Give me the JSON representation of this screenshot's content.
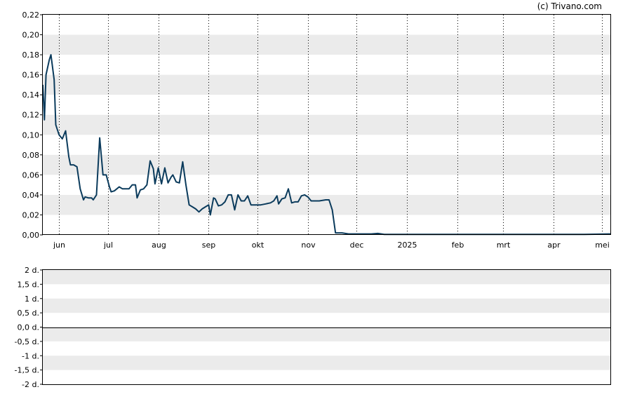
{
  "copyright": "(c) Trivano.com",
  "chart_data": [
    {
      "type": "line",
      "y_ticks": [
        "0,00",
        "0,02",
        "0,04",
        "0,06",
        "0,08",
        "0,10",
        "0,12",
        "0,14",
        "0,16",
        "0,18",
        "0,20",
        "0,22"
      ],
      "ylim": [
        0,
        0.22
      ],
      "grid": "alternating horizontal bands, dotted vertical month lines",
      "x_ticks": [
        {
          "label": "jun",
          "date": "2024-06-01"
        },
        {
          "label": "jul",
          "date": "2024-07-01"
        },
        {
          "label": "aug",
          "date": "2024-08-01"
        },
        {
          "label": "sep",
          "date": "2024-09-01"
        },
        {
          "label": "okt",
          "date": "2024-10-01"
        },
        {
          "label": "nov",
          "date": "2024-11-01"
        },
        {
          "label": "dec",
          "date": "2024-12-01"
        },
        {
          "label": "2025",
          "date": "2025-01-01"
        },
        {
          "label": "feb",
          "date": "2025-02-01"
        },
        {
          "label": "mrt",
          "date": "2025-03-01"
        },
        {
          "label": "apr",
          "date": "2025-04-01"
        },
        {
          "label": "mei",
          "date": "2025-05-01"
        }
      ],
      "xlim": [
        "2024-05-22",
        "2025-05-06"
      ],
      "line_color": "#0b3b5c",
      "series": [
        {
          "points": [
            [
              "2024-05-22",
              0.15
            ],
            [
              "2024-05-23",
              0.115
            ],
            [
              "2024-05-24",
              0.16
            ],
            [
              "2024-05-26",
              0.175
            ],
            [
              "2024-05-27",
              0.18
            ],
            [
              "2024-05-29",
              0.155
            ],
            [
              "2024-05-30",
              0.11
            ],
            [
              "2024-06-01",
              0.1
            ],
            [
              "2024-06-03",
              0.096
            ],
            [
              "2024-06-05",
              0.104
            ],
            [
              "2024-06-07",
              0.078
            ],
            [
              "2024-06-08",
              0.07
            ],
            [
              "2024-06-10",
              0.07
            ],
            [
              "2024-06-12",
              0.068
            ],
            [
              "2024-06-14",
              0.046
            ],
            [
              "2024-06-16",
              0.035
            ],
            [
              "2024-06-17",
              0.038
            ],
            [
              "2024-06-19",
              0.037
            ],
            [
              "2024-06-21",
              0.037
            ],
            [
              "2024-06-22",
              0.035
            ],
            [
              "2024-06-24",
              0.04
            ],
            [
              "2024-06-26",
              0.097
            ],
            [
              "2024-06-28",
              0.06
            ],
            [
              "2024-06-30",
              0.06
            ],
            [
              "2024-07-02",
              0.048
            ],
            [
              "2024-07-03",
              0.043
            ],
            [
              "2024-07-05",
              0.044
            ],
            [
              "2024-07-08",
              0.048
            ],
            [
              "2024-07-10",
              0.046
            ],
            [
              "2024-07-12",
              0.046
            ],
            [
              "2024-07-14",
              0.046
            ],
            [
              "2024-07-16",
              0.05
            ],
            [
              "2024-07-18",
              0.05
            ],
            [
              "2024-07-19",
              0.037
            ],
            [
              "2024-07-21",
              0.045
            ],
            [
              "2024-07-23",
              0.046
            ],
            [
              "2024-07-25",
              0.05
            ],
            [
              "2024-07-27",
              0.074
            ],
            [
              "2024-07-29",
              0.066
            ],
            [
              "2024-07-30",
              0.051
            ],
            [
              "2024-08-01",
              0.067
            ],
            [
              "2024-08-03",
              0.051
            ],
            [
              "2024-08-05",
              0.067
            ],
            [
              "2024-08-07",
              0.052
            ],
            [
              "2024-08-09",
              0.058
            ],
            [
              "2024-08-10",
              0.06
            ],
            [
              "2024-08-12",
              0.053
            ],
            [
              "2024-08-14",
              0.052
            ],
            [
              "2024-08-16",
              0.073
            ],
            [
              "2024-08-18",
              0.05
            ],
            [
              "2024-08-20",
              0.03
            ],
            [
              "2024-08-22",
              0.028
            ],
            [
              "2024-08-24",
              0.026
            ],
            [
              "2024-08-26",
              0.023
            ],
            [
              "2024-08-28",
              0.026
            ],
            [
              "2024-08-30",
              0.028
            ],
            [
              "2024-09-01",
              0.03
            ],
            [
              "2024-09-02",
              0.02
            ],
            [
              "2024-09-04",
              0.037
            ],
            [
              "2024-09-05",
              0.036
            ],
            [
              "2024-09-07",
              0.029
            ],
            [
              "2024-09-09",
              0.03
            ],
            [
              "2024-09-11",
              0.033
            ],
            [
              "2024-09-13",
              0.04
            ],
            [
              "2024-09-15",
              0.04
            ],
            [
              "2024-09-17",
              0.025
            ],
            [
              "2024-09-19",
              0.04
            ],
            [
              "2024-09-21",
              0.034
            ],
            [
              "2024-09-23",
              0.034
            ],
            [
              "2024-09-25",
              0.039
            ],
            [
              "2024-09-27",
              0.03
            ],
            [
              "2024-09-30",
              0.03
            ],
            [
              "2024-10-03",
              0.03
            ],
            [
              "2024-10-06",
              0.031
            ],
            [
              "2024-10-09",
              0.032
            ],
            [
              "2024-10-11",
              0.034
            ],
            [
              "2024-10-13",
              0.039
            ],
            [
              "2024-10-14",
              0.031
            ],
            [
              "2024-10-16",
              0.036
            ],
            [
              "2024-10-18",
              0.037
            ],
            [
              "2024-10-20",
              0.046
            ],
            [
              "2024-10-22",
              0.032
            ],
            [
              "2024-10-24",
              0.033
            ],
            [
              "2024-10-26",
              0.033
            ],
            [
              "2024-10-28",
              0.039
            ],
            [
              "2024-10-30",
              0.04
            ],
            [
              "2024-11-01",
              0.038
            ],
            [
              "2024-11-03",
              0.034
            ],
            [
              "2024-11-05",
              0.034
            ],
            [
              "2024-11-08",
              0.034
            ],
            [
              "2024-11-12",
              0.035
            ],
            [
              "2024-11-14",
              0.035
            ],
            [
              "2024-11-16",
              0.025
            ],
            [
              "2024-11-18",
              0.002
            ],
            [
              "2024-11-22",
              0.002
            ],
            [
              "2024-11-26",
              0.001
            ],
            [
              "2024-12-01",
              0.001
            ],
            [
              "2024-12-10",
              0.001
            ],
            [
              "2024-12-14",
              0.0015
            ],
            [
              "2024-12-18",
              0.0005
            ],
            [
              "2025-01-01",
              0.0005
            ],
            [
              "2025-02-01",
              0.0005
            ],
            [
              "2025-03-01",
              0.0005
            ],
            [
              "2025-04-01",
              0.0005
            ],
            [
              "2025-04-20",
              0.0005
            ],
            [
              "2025-05-06",
              0.001
            ]
          ]
        }
      ]
    },
    {
      "type": "line",
      "y_ticks": [
        "-2 d.",
        "-1,5 d.",
        "-1 d.",
        "-0,5 d.",
        "0,0 d.",
        "0,5 d.",
        "1 d.",
        "1,5 d.",
        "2 d."
      ],
      "ylim": [
        -2,
        2
      ],
      "grid": "alternating horizontal bands, zero line",
      "series": []
    }
  ]
}
